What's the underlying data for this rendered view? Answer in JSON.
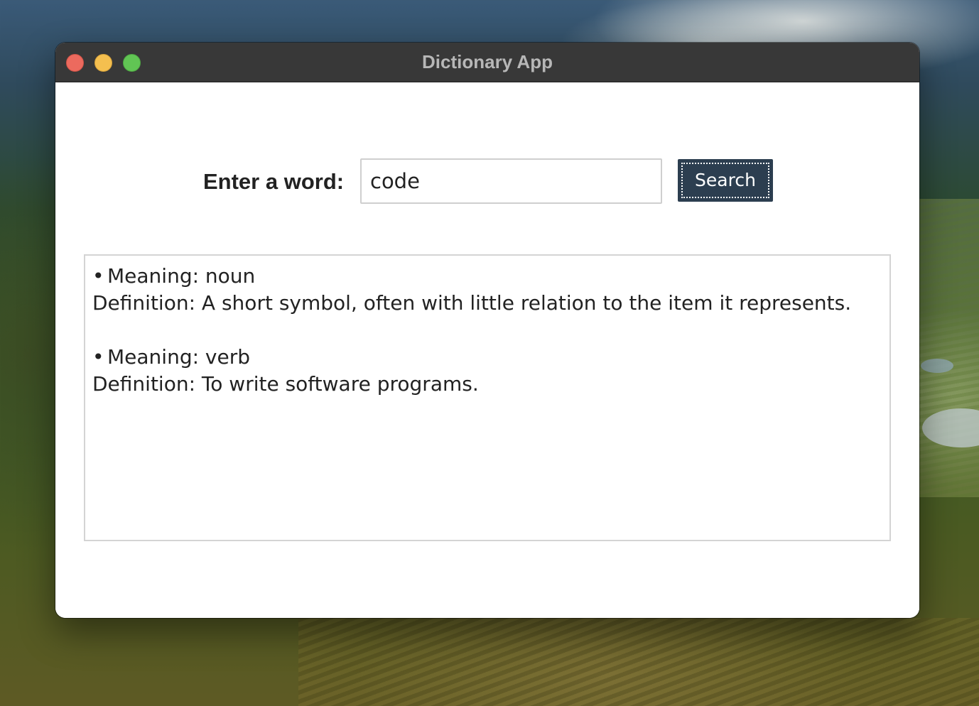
{
  "window": {
    "title": "Dictionary App",
    "controls": [
      "close",
      "minimize",
      "maximize"
    ]
  },
  "search": {
    "label": "Enter a word:",
    "value": "code",
    "button_label": "Search"
  },
  "results": {
    "entries": [
      {
        "bullet": "•",
        "meaning": "Meaning: noun",
        "definition": "Definition: A short symbol, often with little relation to the item it represents."
      },
      {
        "bullet": "•",
        "meaning": "Meaning: verb",
        "definition": "Definition: To write software programs."
      }
    ]
  },
  "colors": {
    "titlebar": "#383838",
    "button_bg": "#2c3e50",
    "close": "#ec6a5e",
    "minimize": "#f4bf4f",
    "maximize": "#61c554"
  }
}
